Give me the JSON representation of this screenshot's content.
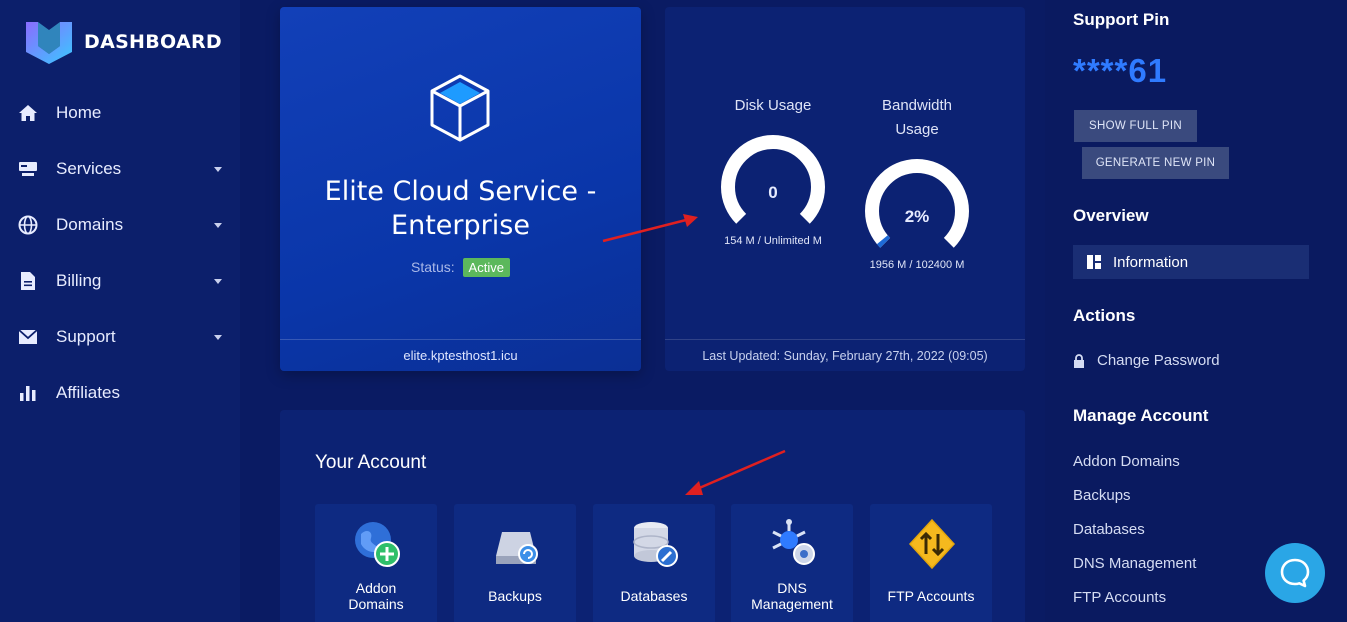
{
  "brand": {
    "name": "DASHBOARD"
  },
  "sidebar": {
    "items": [
      {
        "label": "Home",
        "icon": "home-icon",
        "dropdown": false
      },
      {
        "label": "Services",
        "icon": "server-icon",
        "dropdown": true
      },
      {
        "label": "Domains",
        "icon": "globe-icon",
        "dropdown": true
      },
      {
        "label": "Billing",
        "icon": "file-icon",
        "dropdown": true
      },
      {
        "label": "Support",
        "icon": "envelope-icon",
        "dropdown": true
      },
      {
        "label": "Affiliates",
        "icon": "bar-chart-icon",
        "dropdown": false
      }
    ]
  },
  "service": {
    "title_line1": "Elite Cloud Service -",
    "title_line2": "Enterprise",
    "status_label": "Status:",
    "status_value": "Active",
    "domain": "elite.kptesthost1.icu"
  },
  "usage": {
    "disk": {
      "label": "Disk Usage",
      "value": "0",
      "percent": 0,
      "caption": "154 M / Unlimited M"
    },
    "bandwidth": {
      "label_line1": "Bandwidth",
      "label_line2": "Usage",
      "value": "2%",
      "percent": 2,
      "caption": "1956 M / 102400 M"
    },
    "last_updated": "Last Updated: Sunday, February 27th, 2022 (09:05)"
  },
  "account": {
    "title": "Your Account",
    "tiles": [
      {
        "label_line1": "Addon",
        "label_line2": "Domains",
        "icon": "addon-domains-icon"
      },
      {
        "label_line1": "Backups",
        "label_line2": "",
        "icon": "backups-icon"
      },
      {
        "label_line1": "Databases",
        "label_line2": "",
        "icon": "databases-icon"
      },
      {
        "label_line1": "DNS",
        "label_line2": "Management",
        "icon": "dns-management-icon"
      },
      {
        "label_line1": "FTP Accounts",
        "label_line2": "",
        "icon": "ftp-accounts-icon"
      }
    ]
  },
  "right": {
    "support_pin_title": "Support Pin",
    "pin_value": "****61",
    "show_full_pin": "SHOW FULL PIN",
    "generate_new_pin": "GENERATE NEW PIN",
    "overview_title": "Overview",
    "information": "Information",
    "actions_title": "Actions",
    "change_password": "Change Password",
    "manage_title": "Manage Account",
    "manage_links": [
      "Addon Domains",
      "Backups",
      "Databases",
      "DNS Management",
      "FTP Accounts"
    ]
  },
  "colors": {
    "accent": "#2f7bff",
    "status_active": "#5cb85c",
    "gauge_track": "#ffffff",
    "gauge_fill": "#1e6ad6",
    "chat": "#2aa6e6",
    "arrow": "#e02020"
  }
}
